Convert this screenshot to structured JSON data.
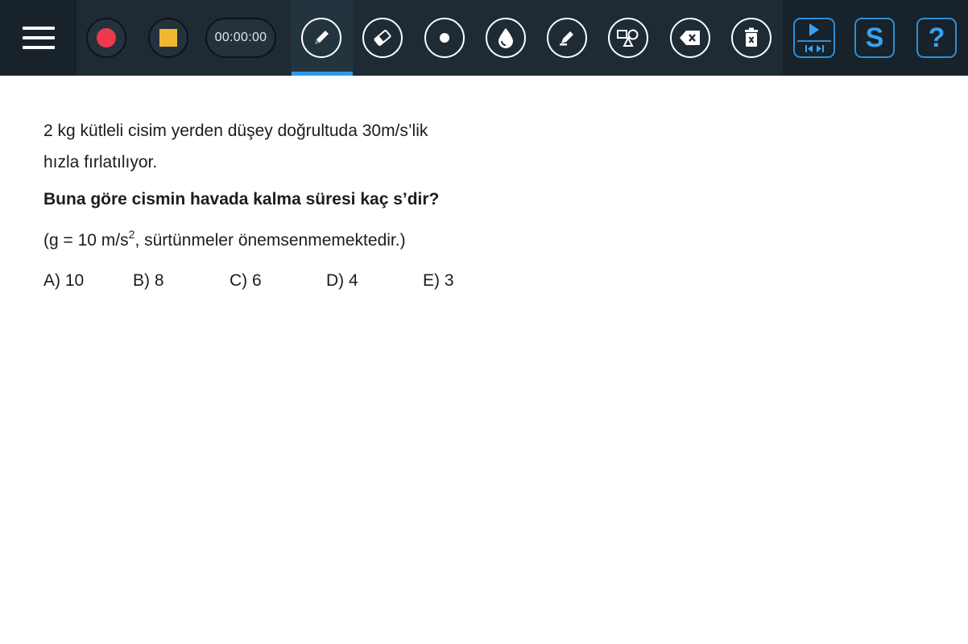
{
  "toolbar": {
    "timer": "00:00:00",
    "accent_color": "#2f9be6",
    "record_color": "#f0394f",
    "stop_color": "#f2b731",
    "icons": [
      "menu-icon",
      "record-icon",
      "stop-icon",
      "pen-icon",
      "eraser-icon",
      "dot-icon",
      "ink-drop-icon",
      "highlighter-icon",
      "shapes-icon",
      "backspace-icon",
      "trash-icon",
      "play-icon",
      "skip-back-icon",
      "skip-forward-icon",
      "s-logo-icon",
      "help-icon"
    ],
    "s_label": "S",
    "help_label": "?"
  },
  "question": {
    "line1": "2 kg kütleli cisim yerden düşey doğrultuda 30m/s’lik",
    "line2": "hızla fırlatılıyor.",
    "prompt": "Buna göre cismin havada kalma süresi kaç s’dir?",
    "note_start": "(g = 10 m/s",
    "note_sup": "2",
    "note_end": ", sürtünmeler önemsenmemektedir.)",
    "choices": [
      "A) 10",
      "B) 8",
      "C) 6",
      "D) 4",
      "E) 3"
    ]
  }
}
